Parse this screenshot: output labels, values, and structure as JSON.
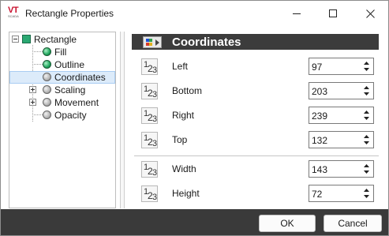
{
  "window": {
    "title": "Rectangle Properties",
    "icon_text": "VT",
    "icon_subtext": "SCADA"
  },
  "tree": {
    "root": {
      "label": "Rectangle",
      "expanded": true
    },
    "items": [
      {
        "label": "Fill",
        "status": "green"
      },
      {
        "label": "Outline",
        "status": "green"
      },
      {
        "label": "Coordinates",
        "status": "gray",
        "selected": true
      },
      {
        "label": "Scaling",
        "status": "gray",
        "expandable": true
      },
      {
        "label": "Movement",
        "status": "gray",
        "expandable": true
      },
      {
        "label": "Opacity",
        "status": "gray"
      }
    ]
  },
  "section": {
    "title": "Coordinates",
    "icon": "palette-arrow-icon"
  },
  "properties": [
    {
      "label": "Left",
      "value": "97"
    },
    {
      "label": "Bottom",
      "value": "203"
    },
    {
      "label": "Right",
      "value": "239"
    },
    {
      "label": "Top",
      "value": "132"
    },
    {
      "label": "Width",
      "value": "143"
    },
    {
      "label": "Height",
      "value": "72"
    }
  ],
  "number_icon": {
    "d1": "1",
    "d2": "2",
    "d3": "3"
  },
  "footer": {
    "ok_label": "OK",
    "cancel_label": "Cancel"
  },
  "colors": {
    "header_bg": "#3c3c3c",
    "footer_bg": "#3a3a3a",
    "selection_bg": "#dcebfa",
    "status_green": "#1fa55d",
    "status_gray": "#b4b4b4",
    "root_node": "#2aa872",
    "brand_red": "#c8102e"
  }
}
